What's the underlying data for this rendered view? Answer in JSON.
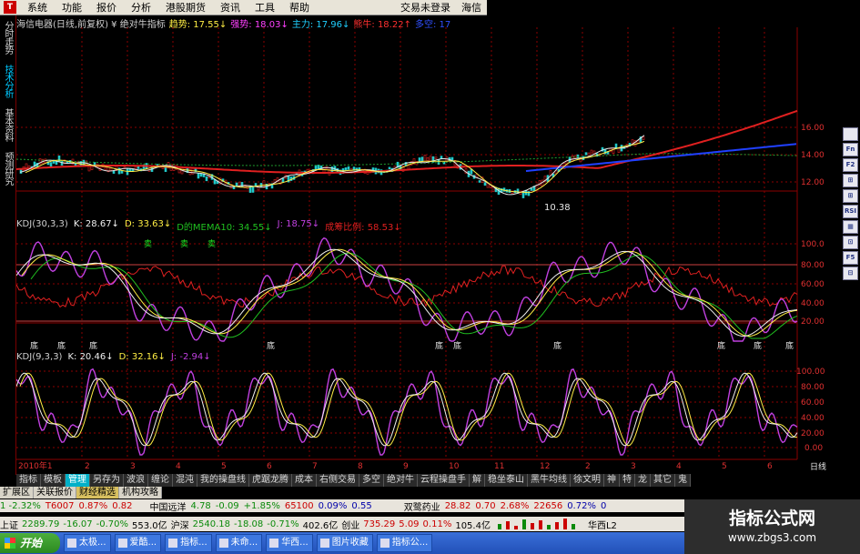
{
  "menu": {
    "items": [
      "系统",
      "功能",
      "报价",
      "分析",
      "港股期货",
      "资讯",
      "工具",
      "帮助"
    ],
    "right": [
      "交易未登录",
      "海信"
    ]
  },
  "left_tabs": [
    "分时走势",
    "技术分析",
    "基本资料",
    "预测研究"
  ],
  "title_row": {
    "stock": "海信电器(日线,前复权) ¥ 绝对牛指标",
    "trend": "趋势: 17.55↓",
    "strong": "强势: 18.03↓",
    "main": "主力: 17.96↓",
    "bull": "熊牛: 18.22↑",
    "blue": "多空: 17"
  },
  "price_axis": [
    "16.00",
    "14.00",
    "12.00"
  ],
  "low_label": "10.38",
  "kdj1": {
    "name": "KDJ(30,3,3)",
    "k": "K: 28.67↓",
    "d": "D: 33.63↓",
    "dma": "D的MEMA10: 34.55↓",
    "j": "J: 18.75↓",
    "ratio": "成筹比例: 58.53↓",
    "axis": [
      "100.0",
      "80.00",
      "60.00",
      "40.00",
      "20.00"
    ],
    "top_labels": [
      "卖",
      "卖",
      "卖",
      "卖"
    ],
    "bottom_labels": [
      "底",
      "底",
      "底",
      "底",
      "底",
      "底",
      "底",
      "底",
      "底",
      "底"
    ]
  },
  "kdj2": {
    "name": "KDJ(9,3,3)",
    "k": "K: 20.46↓",
    "d": "D: 32.16↓",
    "j": "J: -2.94↓",
    "axis": [
      "100.00",
      "80.00",
      "60.00",
      "40.00",
      "20.00",
      "0.00"
    ]
  },
  "x_axis": {
    "start": "2010年1",
    "months": [
      "2",
      "3",
      "4",
      "5",
      "6",
      "7",
      "8",
      "9",
      "10",
      "11",
      "12",
      "2",
      "3",
      "4",
      "5",
      "6"
    ],
    "period": "日线"
  },
  "bottom_tabs": [
    "指标",
    "模板",
    "管理",
    "另存为",
    "波浪",
    "缠论",
    "混沌",
    "我的操盘线",
    "虎踞龙腾",
    "成本",
    "右侧交易",
    "多空",
    "绝对牛",
    "云程操盘手",
    "解",
    "稳坐泰山",
    "黑牛均线",
    "徐文明",
    "神",
    "特",
    "龙",
    "其它",
    "鬼"
  ],
  "extra_tabs": [
    "扩展区",
    "关联报价",
    "财经精选",
    "机构攻略"
  ],
  "ticker": {
    "a": "1  -2.32%",
    "b": "T6007",
    "c": "0.87%",
    "d": "0.82",
    "name1": "中国远洋",
    "v1": "4.78",
    "v2": "-0.09",
    "v3": "+1.85%",
    "v4": "65100",
    "v5": "0.09%",
    "v6": "0.55",
    "name2": "双鹭药业",
    "v7": "28.82",
    "v8": "0.70",
    "v9": "2.68%",
    "v10": "22656",
    "v11": "0.72%",
    "v12": "0"
  },
  "status": {
    "sh_label": "上证",
    "sh": "2289.79",
    "sh_chg": "-16.07",
    "sh_pct": "-0.70%",
    "sh_amt": "553.0亿",
    "sz_label": "沪深",
    "sz": "2540.18",
    "sz_chg": "-18.08",
    "sz_pct": "-0.71%",
    "sz_amt": "402.6亿",
    "cy_label": "创业",
    "cy": "735.29",
    "cy_chg": "5.09",
    "cy_pct": "0.11%",
    "cy_amt": "105.4亿",
    "right": "华西L2"
  },
  "taskbar": {
    "start": "开始",
    "tasks": [
      "太极...",
      "爱酷...",
      "指标...",
      "未命...",
      "华西...",
      "图片收藏",
      "指标公..."
    ]
  },
  "right_tools": [
    "",
    "Fn",
    "F2",
    "⊞",
    "⊞",
    "RSI",
    "▦",
    "⊡",
    "F5",
    "⊟"
  ],
  "watermark": {
    "title": "指标公式网",
    "url": "www.zbgs3.com"
  },
  "colors": {
    "red": "#e02020",
    "white": "#f0f0f0",
    "yellow": "#ffee44",
    "magenta": "#c040e0",
    "green": "#20c020",
    "blue": "#2040ff"
  }
}
